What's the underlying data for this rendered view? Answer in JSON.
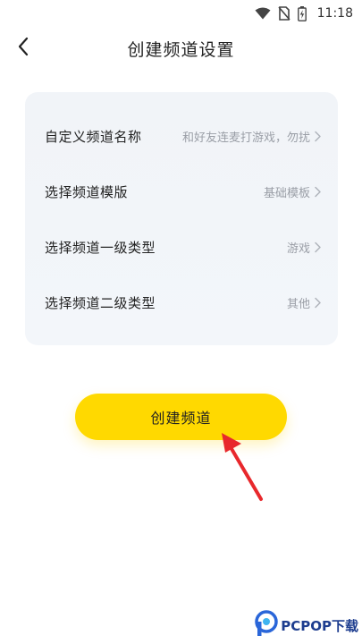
{
  "status_bar": {
    "time": "11:18",
    "icons": [
      "wifi-icon",
      "no-sim-icon",
      "battery-charging-icon"
    ]
  },
  "header": {
    "title": "创建频道设置",
    "back_icon": "chevron-left-icon"
  },
  "settings": {
    "rows": [
      {
        "label": "自定义频道名称",
        "value": "和好友连麦打游戏，勿扰"
      },
      {
        "label": "选择频道模版",
        "value": "基础模板"
      },
      {
        "label": "选择频道一级类型",
        "value": "游戏"
      },
      {
        "label": "选择频道二级类型",
        "value": "其他"
      }
    ]
  },
  "create_button": {
    "label": "创建频道"
  },
  "annotation": {
    "arrow_color": "#e8282c"
  },
  "watermark": {
    "text": "PCPOP下载"
  },
  "colors": {
    "accent": "#ffd900",
    "card_bg": "#f1f4f8",
    "muted_text": "#9a9ea6"
  }
}
